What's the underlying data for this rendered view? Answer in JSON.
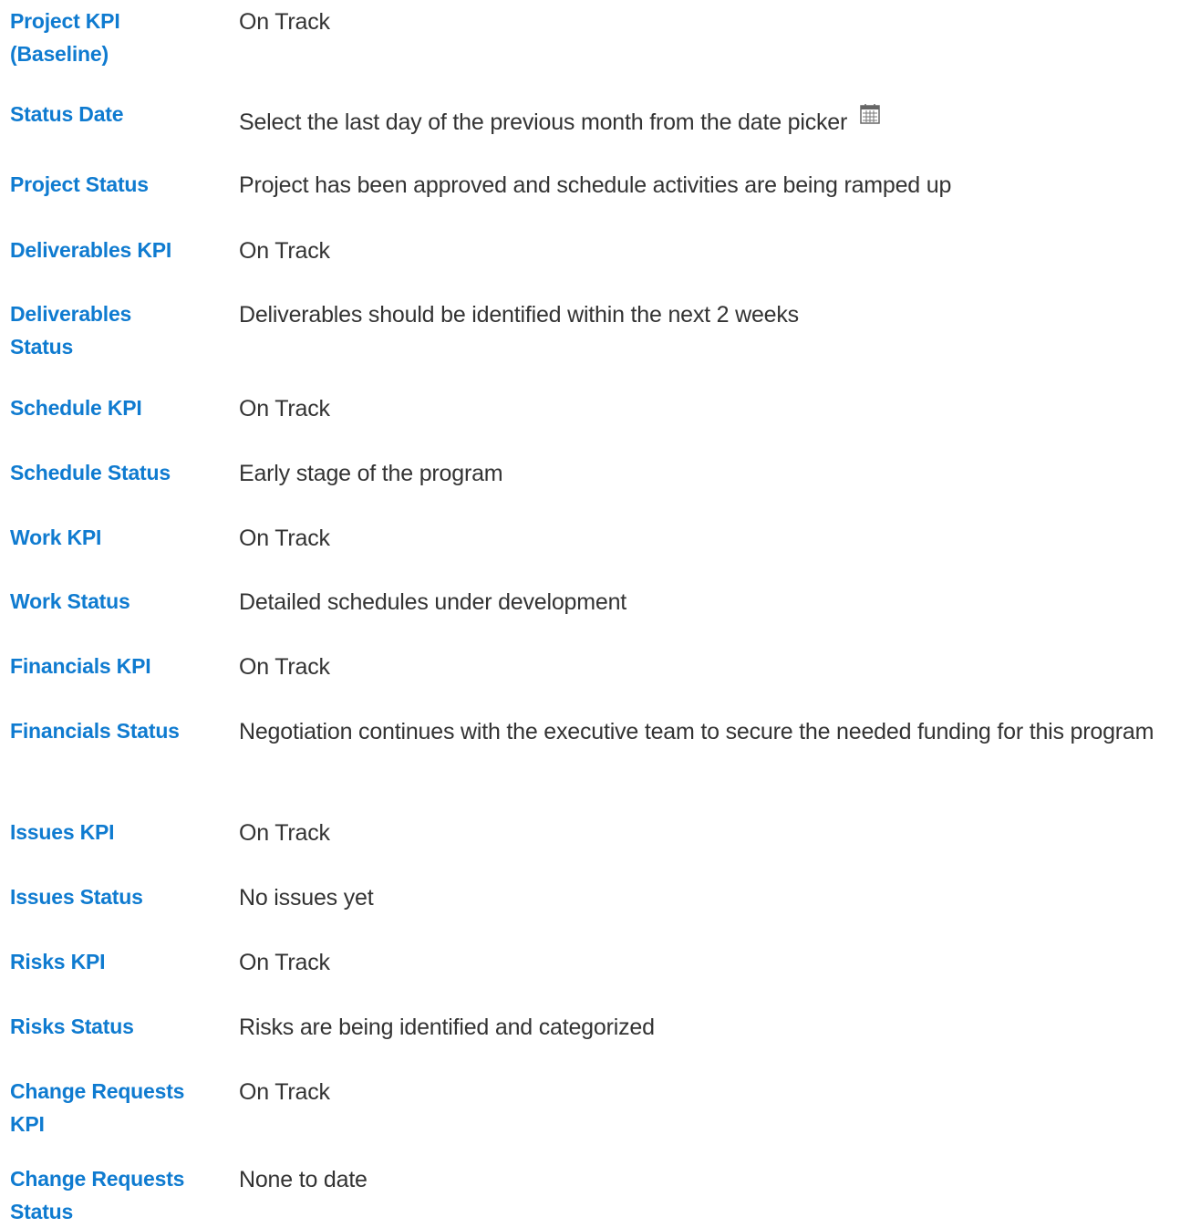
{
  "fields": [
    {
      "label": "Project KPI (Baseline)",
      "value": "On Track"
    },
    {
      "label": "Status Date",
      "value": "Select the last day of the previous month from the date picker"
    },
    {
      "label": "Project Status",
      "value": "Project has been approved and schedule activities are being ramped up"
    },
    {
      "label": "Deliverables KPI",
      "value": "On Track"
    },
    {
      "label": "Deliverables Status",
      "value": "Deliverables should be identified within the next 2 weeks"
    },
    {
      "label": "Schedule KPI",
      "value": "On Track"
    },
    {
      "label": "Schedule Status",
      "value": "Early stage of the program"
    },
    {
      "label": "Work KPI",
      "value": "On Track"
    },
    {
      "label": "Work Status",
      "value": "Detailed schedules under development"
    },
    {
      "label": "Financials KPI",
      "value": "On Track"
    },
    {
      "label": "Financials Status",
      "value": "Negotiation continues with the executive team to secure the needed funding for this program"
    },
    {
      "label": "Issues KPI",
      "value": "On Track"
    },
    {
      "label": "Issues Status",
      "value": "No issues yet"
    },
    {
      "label": "Risks KPI",
      "value": "On Track"
    },
    {
      "label": "Risks Status",
      "value": "Risks are being identified and categorized"
    },
    {
      "label": "Change Requests KPI",
      "value": "On Track"
    },
    {
      "label": "Change Requests Status",
      "value": "None to date"
    }
  ],
  "icons": {
    "status_date_picker": "calendar-icon"
  },
  "colors": {
    "label": "#0f7bd0",
    "value": "#333333",
    "background": "#ffffff"
  }
}
